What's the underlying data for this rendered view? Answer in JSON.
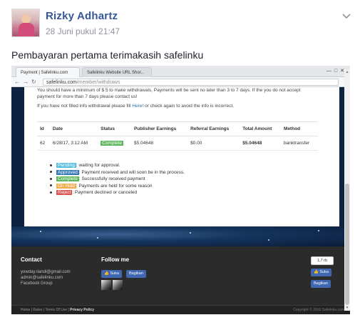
{
  "post": {
    "author": "Rizky Adhartz",
    "timestamp": "28 Juni pukul 21:47",
    "text": "Pembayaran pertama terimakasih safelinku"
  },
  "screenshot": {
    "tabs": [
      "Payment | Safelinku.com",
      "Safelinku Website URL Shor..."
    ],
    "url_host": "safelinku.com",
    "url_path": "/member/withdraws",
    "notice_1": "You should have a minimum of $ 5 to make withdrawals, Payments will be sent no later than 3 to 7 days. If the you do not accept",
    "notice_2": "payment for more than 7 days please contact us!",
    "notice_3_before": "If you have not filled info withdrawal please fill",
    "notice_3_link": "Here!",
    "notice_3_after": "or check again to avoid the info is incorrect.",
    "table": {
      "headers": [
        "Id",
        "Date",
        "Status",
        "Publisher Earnings",
        "Referral Earnings",
        "Total Amount",
        "Method"
      ],
      "rows": [
        {
          "id": "62",
          "date": "6/28/17, 3:12 AM",
          "status": "Complete",
          "publisher": "$5.04648",
          "referral": "$0.00",
          "total": "$5.04648",
          "method": "banktransfer"
        }
      ]
    },
    "legend": [
      {
        "label": "Pending",
        "desc": ": waiting for approval."
      },
      {
        "label": "Approved",
        "desc": ": Payment received and will soon be in the process."
      },
      {
        "label": "Complete",
        "desc": ": Successfully received payment"
      },
      {
        "label": "On Hold",
        "desc": ": Payments are held for some reason"
      },
      {
        "label": "Reject",
        "desc": ": Payment declined or canceled"
      }
    ],
    "footer": {
      "contact_title": "Contact",
      "contact_lines": [
        "yowday.riandi@gmail.com",
        "admin@safelinku.com",
        "Facebook Group"
      ],
      "follow_title": "Follow me",
      "like_label": "Suka",
      "share_label": "Bagikan",
      "count": "1,7 rb",
      "links": [
        "Home",
        "Rates",
        "Terms Of Use",
        "Privacy Policy"
      ],
      "copyright": "Copyright © 2016 Safelinku.com"
    }
  },
  "colors": {
    "fb_blue": "#365899",
    "fb_button": "#4267b2",
    "status_complete": "#5cb85c",
    "status_pending": "#5bc0de",
    "status_approved": "#337ab7",
    "status_onhold": "#f0ad4e",
    "status_reject": "#d9534f"
  },
  "icons": [
    "chevron-down-icon",
    "back-arrow-icon",
    "forward-arrow-icon",
    "reload-icon",
    "menu-icon",
    "thumbs-up-icon"
  ]
}
